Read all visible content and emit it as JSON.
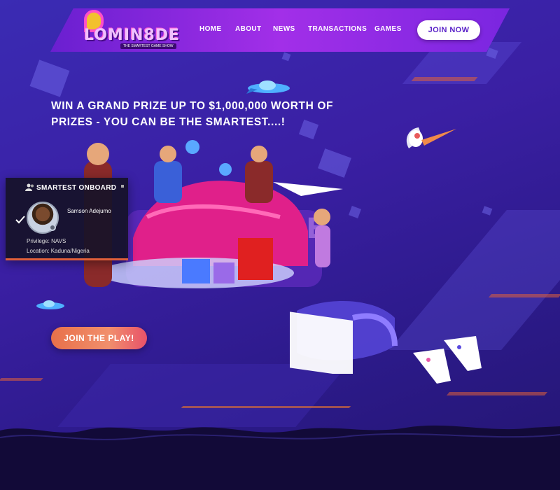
{
  "brand": {
    "name": "LOMIN8DE",
    "tagline": "THE SMARTEST GAME SHOW"
  },
  "nav": {
    "items": [
      {
        "label": "HOME"
      },
      {
        "label": "ABOUT"
      },
      {
        "label": "NEWS"
      },
      {
        "label": "TRANSACTIONS"
      },
      {
        "label": "GAMES"
      }
    ],
    "cta_label": "JOIN NOW"
  },
  "hero": {
    "title": "WIN A GRAND PRIZE UP TO $1,000,000 WORTH OF PRIZES - YOU CAN BE THE SMARTEST....!",
    "cta_label": "JOIN THE PLAY!"
  },
  "onboard": {
    "header": "SMARTEST ONBOARD",
    "member_name": "Samson Adejumo",
    "privilege": "Privilege: NAVS",
    "location": "Location: Kaduna/Nigeria"
  },
  "colors": {
    "background": "#3a2bb3",
    "nav_gradient_start": "#6a1fd0",
    "nav_gradient_end": "#a22fe8",
    "accent_orange": "#e8704a",
    "panel_bg": "#16122a"
  }
}
